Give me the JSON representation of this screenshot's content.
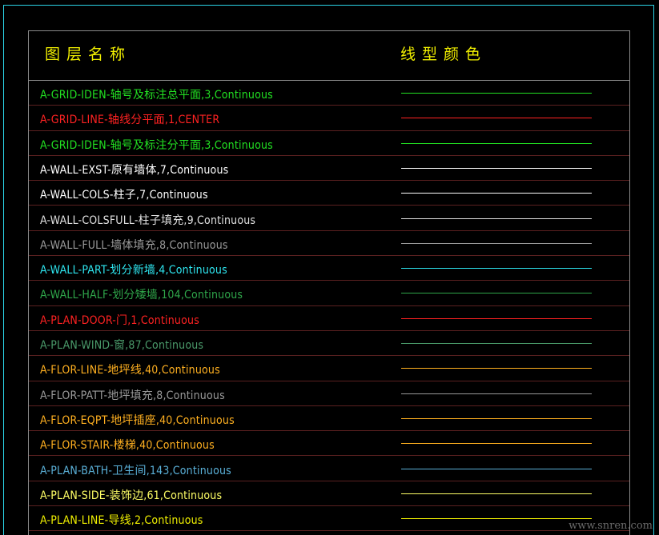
{
  "header": {
    "col_name": "图层名称",
    "col_color": "线型颜色"
  },
  "watermark": "www.snren.com",
  "rows": [
    {
      "label": "A-GRID-IDEN-轴号及标注总平面,3,Continuous",
      "color": "#22e022"
    },
    {
      "label": "A-GRID-LINE-轴线分平面,1,CENTER",
      "color": "#ff2222"
    },
    {
      "label": "A-GRID-IDEN-轴号及标注分平面,3,Continuous",
      "color": "#22e022"
    },
    {
      "label": "A-WALL-EXST-原有墙体,7,Continuous",
      "color": "#ffffff"
    },
    {
      "label": "A-WALL-COLS-柱子,7,Continuous",
      "color": "#ffffff"
    },
    {
      "label": "A-WALL-COLSFULL-柱子填充,9,Continuous",
      "color": "#e0e0e0"
    },
    {
      "label": "A-WALL-FULL-墙体填充,8,Continuous",
      "color": "#9a9a9a"
    },
    {
      "label": "A-WALL-PART-划分新墙,4,Continuous",
      "color": "#2ee6f0"
    },
    {
      "label": "A-WALL-HALF-划分矮墙,104,Continuous",
      "color": "#2fa64a"
    },
    {
      "label": "A-PLAN-DOOR-门,1,Continuous",
      "color": "#ff2222"
    },
    {
      "label": "A-PLAN-WIND-窗,87,Continuous",
      "color": "#4a9a6a"
    },
    {
      "label": "A-FLOR-LINE-地坪线,40,Continuous",
      "color": "#ffb020"
    },
    {
      "label": "A-FLOR-PATT-地坪填充,8,Continuous",
      "color": "#9a9a9a"
    },
    {
      "label": "A-FLOR-EQPT-地坪插座,40,Continuous",
      "color": "#ffb020"
    },
    {
      "label": "A-FLOR-STAIR-楼梯,40,Continuous",
      "color": "#ffb020"
    },
    {
      "label": "A-PLAN-BATH-卫生间,143,Continuous",
      "color": "#5ab0d8"
    },
    {
      "label": "A-PLAN-SIDE-装饰边,61,Continuous",
      "color": "#ffff66"
    },
    {
      "label": "A-PLAN-LINE-导线,2,Continuous",
      "color": "#f0f000"
    }
  ]
}
